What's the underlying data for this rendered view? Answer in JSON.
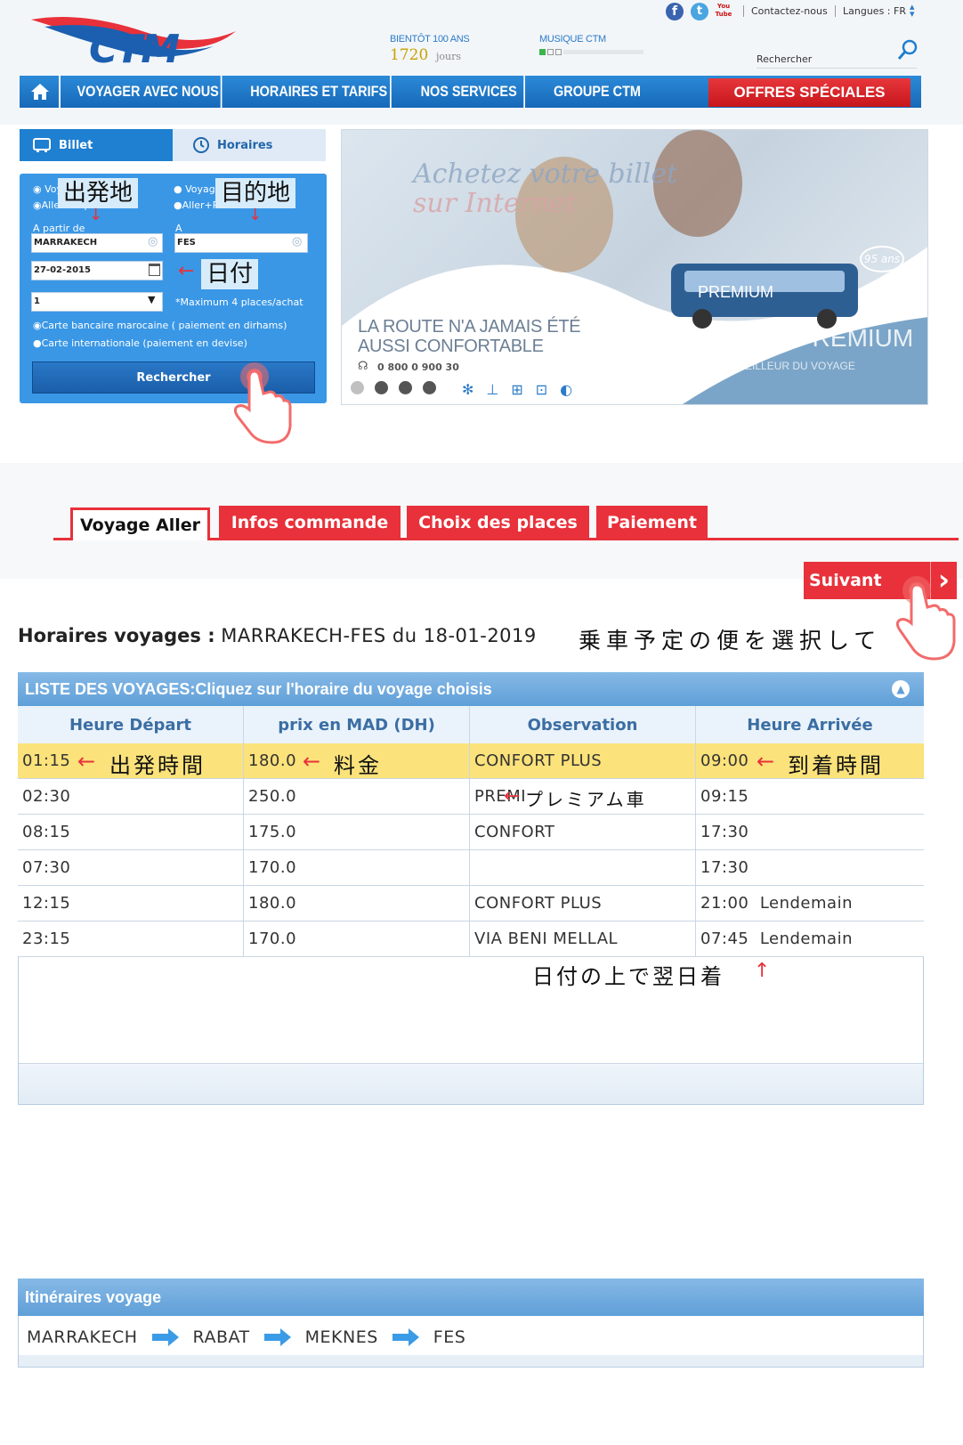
{
  "header": {
    "logo": "CTM",
    "top_links": {
      "contact": "Contactez-nous",
      "langues": "Langues : FR"
    },
    "social": {
      "facebook": "f",
      "twitter": "t",
      "youtube": "You Tube"
    },
    "anniversary": {
      "label": "BIENTÔT 100 ANS",
      "count": "1720",
      "unit": "jours"
    },
    "music": {
      "label": "MUSIQUE CTM"
    },
    "search_placeholder": "Rechercher"
  },
  "nav": {
    "items": [
      "VOYAGER AVEC NOUS",
      "HORAIRES ET TARIFS",
      "NOS SERVICES",
      "GROUPE CTM"
    ],
    "special": "OFFRES SPÉCIALES"
  },
  "booking": {
    "tab_billet": "Billet",
    "tab_horaires": "Horaires",
    "radio_voyage_1": "Voy",
    "radio_aller_simple": "Aller simp",
    "radio_voyage_2": "Voyag",
    "radio_aller_retour": "Aller+Retour",
    "from_label": "A partir de",
    "from_value": "MARRAKECH",
    "to_label": "A",
    "to_value": "FES",
    "date_value": "27-02-2015",
    "qty_value": "1",
    "max_note": "*Maximum 4 places/achat",
    "pay_option_1": "Carte bancaire marocaine ( paiement en dirhams)",
    "pay_option_2": "Carte internationale (paiement en devise)",
    "search_button": "Rechercher",
    "annotations": {
      "origin": "出発地",
      "destination": "目的地",
      "date": "日付"
    }
  },
  "banner": {
    "headline_1": "Achetez votre billet",
    "headline_2": "sur Internet",
    "tagline_1": "LA ROUTE N'A JAMAIS ÉTÉ",
    "tagline_2": "AUSSI CONFORTABLE",
    "phone": "0 800 0 900 30",
    "badge": "95 ans",
    "premium": "PREMIUM",
    "bus_label": "PREMIUM",
    "slogan": "LE MEILLEUR DU VOYAGE"
  },
  "steps": {
    "tabs": [
      "Voyage Aller",
      "Infos commande",
      "Choix des places",
      "Paiement"
    ],
    "next_button": "Suivant",
    "next_arrow": "›"
  },
  "schedule": {
    "title_bold": "Horaires voyages :",
    "title_rest": "MARRAKECH-FES du 18-01-2019",
    "annotation": "乗車予定の便を選択して",
    "list_title": "LISTE DES VOYAGES:Cliquez sur l'horaire du voyage choisis",
    "columns": [
      "Heure Départ",
      "prix en MAD (DH)",
      "Observation",
      "Heure Arrivée"
    ],
    "rows": [
      {
        "depart": "01:15",
        "price": "180.0",
        "obs": "CONFORT  PLUS",
        "arrival": "09:00"
      },
      {
        "depart": "02:30",
        "price": "250.0",
        "obs": "PREMIUM",
        "arrival": "09:15"
      },
      {
        "depart": "08:15",
        "price": "175.0",
        "obs": "CONFORT",
        "arrival": "17:30"
      },
      {
        "depart": "07:30",
        "price": "170.0",
        "obs": "",
        "arrival": "17:30"
      },
      {
        "depart": "12:15",
        "price": "180.0",
        "obs": "CONFORT  PLUS",
        "arrival": "21:00  Lendemain"
      },
      {
        "depart": "23:15",
        "price": "170.0",
        "obs": "VIA BENI MELLAL",
        "arrival": "07:45  Lendemain"
      }
    ],
    "row_annotations": {
      "depart": "出発時間",
      "price": "料金",
      "arrival": "到着時間",
      "premium": "プレミアム車",
      "next_day": "日付の上で翌日着"
    },
    "selected_row": 0
  },
  "itinerary": {
    "title": "Itinéraires voyage",
    "stops": [
      "MARRAKECH",
      "RABAT",
      "MEKNES",
      "FES"
    ]
  },
  "colors": {
    "brand_blue": "#1c6fc2",
    "accent_red": "#e8313a",
    "highlight_row": "#fbe27a",
    "panel_blue": "#3a97e6"
  }
}
